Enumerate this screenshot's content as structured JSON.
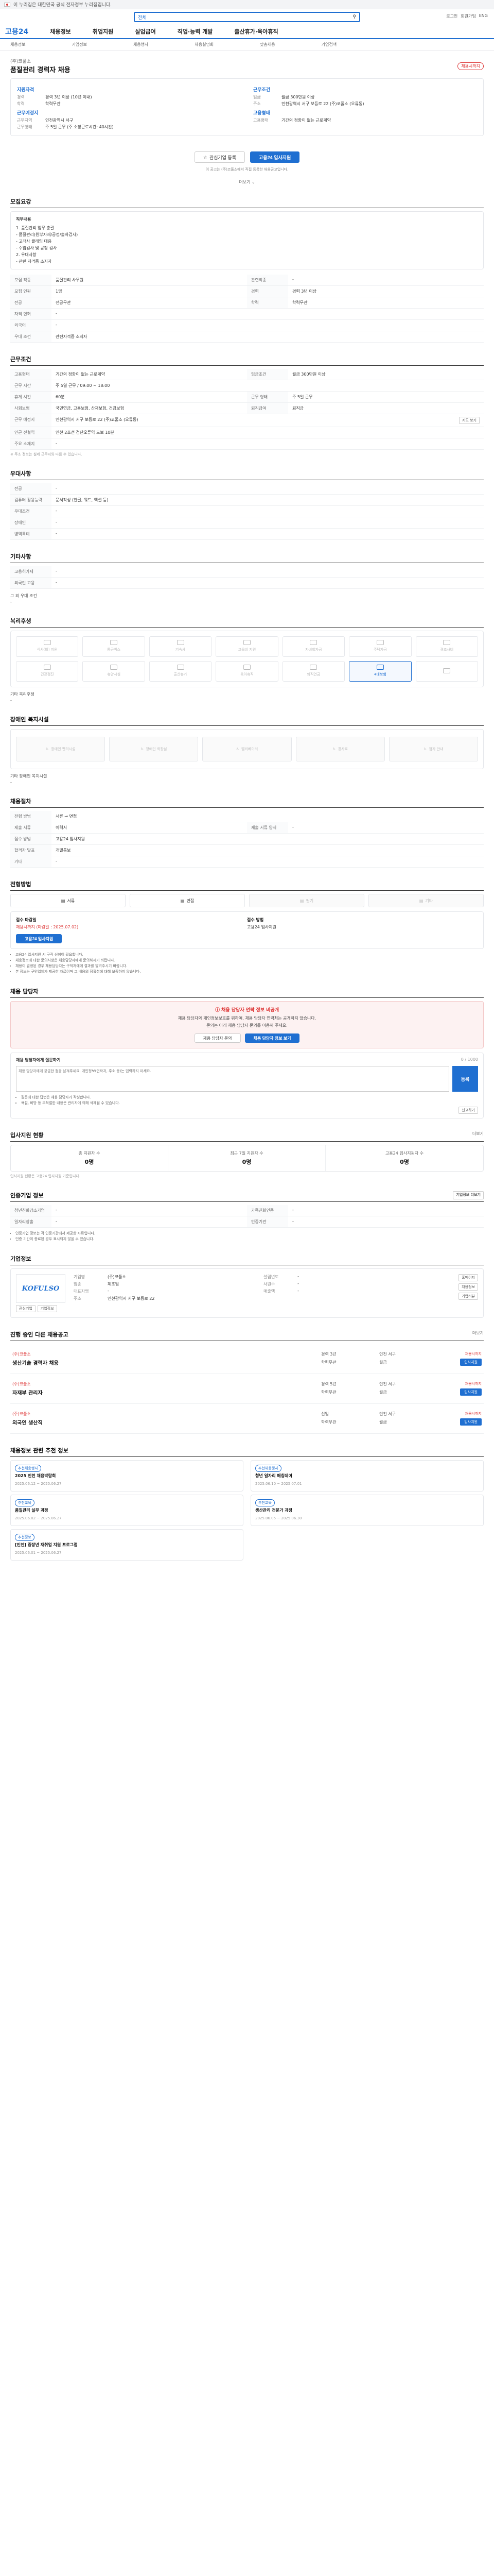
{
  "topbar": {
    "text": "이 누리집은 대한민국 공식 전자정부 누리집입니다."
  },
  "search": {
    "category": "전체",
    "placeholder": "",
    "user_links": [
      "로그인",
      "회원가입",
      "ENG"
    ]
  },
  "gnb": {
    "logo": "고용24",
    "items": [
      "채용정보",
      "취업지원",
      "실업급여",
      "직업·능력 개발",
      "출산휴가·육아휴직"
    ]
  },
  "subnav": [
    "채용정보",
    "기업정보",
    "채용행사",
    "채용설명회",
    "맞춤채용",
    "기업검색"
  ],
  "job": {
    "company": "(주)코풀소",
    "title": "품질관리 경력자 채용",
    "badge": "채용시까지",
    "summary_left_title": "지원자격",
    "summary_left": [
      {
        "k": "경력",
        "v": "경력 3년 이상 (10년 이내)"
      },
      {
        "k": "학력",
        "v": "학력무관"
      }
    ],
    "summary_left_title2": "근무예정지",
    "summary_left2": [
      {
        "k": "근무지역",
        "v": "인천광역시 서구"
      },
      {
        "k": "근무형태",
        "v": "주 5일 근무 (주 소정근로시간: 40시간)"
      }
    ],
    "summary_right_title": "근무조건",
    "summary_right": [
      {
        "k": "임금",
        "v": "월급 300만원 이상"
      },
      {
        "k": "주소",
        "v": "인천광역시 서구 보듬로 22 (주)코풀소 (오류동)"
      }
    ],
    "summary_right_title2": "고용형태",
    "summary_right2": [
      {
        "k": "고용형태",
        "v": "기간의 정함이 없는 근로계약"
      }
    ],
    "btn_interest": "관심기업 등록",
    "btn_apply": "고용24 입사지원",
    "notice": "이 공고는 (주)코풀소에서 직접 등록한 채용공고입니다.",
    "more": "더보기"
  },
  "sections": {
    "recruit": {
      "title": "모집요강",
      "duty_label": "직무내용",
      "duty_lines": [
        "1. 품질관리 업무 총괄",
        " - 품질관리(원부자재/공정/출하검사)",
        " - 고객사 클레임 대응",
        " - 수입검사 및 공정 검사",
        "2. 우대사항",
        " - 관련 자격증 소지자"
      ],
      "rows": [
        {
          "k": "모집 직종",
          "v": "품질관리 사무원",
          "k2": "관련직종",
          "v2": "-"
        },
        {
          "k": "모집 인원",
          "v": "1명",
          "k2": "경력",
          "v2": "경력 3년 이상"
        },
        {
          "k": "전공",
          "v": "전공무관",
          "k2": "학력",
          "v2": "학력무관"
        },
        {
          "k": "자격 면허",
          "v": "-",
          "k2": "",
          "v2": ""
        },
        {
          "k": "외국어",
          "v": "-",
          "k2": "",
          "v2": ""
        },
        {
          "k": "우대 조건",
          "v": "관련자격증 소지자",
          "k2": "",
          "v2": ""
        }
      ]
    },
    "condition": {
      "title": "근무조건",
      "rows": [
        {
          "k": "고용형태",
          "v": "기간의 정함이 없는 근로계약",
          "k2": "임금조건",
          "v2": "월급 300만원 이상"
        },
        {
          "k": "근무 시간",
          "v": "주 5일 근무 / 09:00 ~ 18:00",
          "k2": "",
          "v2": ""
        },
        {
          "k": "휴게 시간",
          "v": "60분",
          "k2": "근무 형태",
          "v2": "주 5일 근무"
        },
        {
          "k": "사회보험",
          "v": "국민연금, 고용보험, 산재보험, 건강보험",
          "k2": "퇴직급여",
          "v2": "퇴직금"
        },
        {
          "k": "근무 예정지",
          "v": "인천광역시 서구 보듬로 22 (주)코풀소 (오류동)",
          "k2": "",
          "v2": ""
        },
        {
          "k": "인근 전철역",
          "v": "인천 2호선 검단오류역 도보 10분",
          "k2": "",
          "v2": ""
        },
        {
          "k": "주요 소재지",
          "v": "-",
          "k2": "",
          "v2": ""
        }
      ],
      "map_btn": "지도 보기",
      "footnote": "※ 주소 정보는 실제 근무지와 다를 수 있습니다."
    },
    "etc": {
      "title": "우대사항",
      "rows": [
        {
          "k": "전공",
          "v": "-"
        },
        {
          "k": "컴퓨터 활용능력",
          "v": "문서작성 (한글, 워드, 엑셀 등)"
        },
        {
          "k": "우대조건",
          "v": "-"
        },
        {
          "k": "장애인",
          "v": "-"
        },
        {
          "k": "병역특례",
          "v": "-"
        }
      ]
    },
    "other": {
      "title": "기타사항",
      "rows": [
        {
          "k": "고용허가제",
          "v": "-"
        },
        {
          "k": "외국인 고용",
          "v": "-"
        }
      ],
      "more_label": "그 외 우대 조건",
      "more_value": "-"
    },
    "welfare": {
      "title": "복리후생",
      "cells": [
        {
          "label": "식사(비) 지원",
          "on": false
        },
        {
          "label": "통근버스",
          "on": false
        },
        {
          "label": "기숙사",
          "on": false
        },
        {
          "label": "교육비 지원",
          "on": false
        },
        {
          "label": "자녀학자금",
          "on": false
        },
        {
          "label": "주택자금",
          "on": false
        },
        {
          "label": "경조사비",
          "on": false
        },
        {
          "label": "건강검진",
          "on": false
        },
        {
          "label": "휴양시설",
          "on": false
        },
        {
          "label": "출산휴가",
          "on": false
        },
        {
          "label": "육아휴직",
          "on": false
        },
        {
          "label": "퇴직연금",
          "on": false
        },
        {
          "label": "4대보험",
          "on": true
        },
        {
          "label": "",
          "on": false
        }
      ],
      "other_label": "기타 복리후생",
      "other_value": "-"
    },
    "disabled": {
      "title": "장애인 복지시설",
      "cells": [
        "장애인 편의시설",
        "장애인 화장실",
        "엘리베이터",
        "경사로",
        "점자 안내"
      ],
      "other_label": "기타 장애인 복지시설",
      "other_value": "-"
    },
    "selection": {
      "title": "채용절차",
      "rows": [
        {
          "k": "전형 방법",
          "v": "서류 → 면접",
          "k2": "",
          "v2": ""
        },
        {
          "k": "제출 서류",
          "v": "이력서",
          "k2": "제출 서류 양식",
          "v2": "-"
        },
        {
          "k": "접수 방법",
          "v": "고용24 입사지원",
          "k2": "",
          "v2": ""
        },
        {
          "k": "합격자 발표",
          "v": "개별통보",
          "k2": "",
          "v2": ""
        },
        {
          "k": "기타",
          "v": "-",
          "k2": "",
          "v2": ""
        }
      ]
    },
    "method": {
      "title": "전형방법",
      "cells": [
        {
          "label": "서류",
          "on": true
        },
        {
          "label": "면접",
          "on": true
        },
        {
          "label": "필기",
          "on": false
        },
        {
          "label": "기타",
          "on": false
        }
      ]
    },
    "apply": {
      "l1": "접수 마감일",
      "v1": "채용시까지 (마감일 : 2025.07.02)",
      "l2": "접수 방법",
      "v2": "고용24 입사지원",
      "btn": "고용24 입사지원",
      "warnings": [
        "고용24 입사지원 시 구직 신청이 필요합니다.",
        "채용정보에 대한 문의사항은 채용담당자에게 문의하시기 바랍니다.",
        "채용이 결정된 경우 채용담당자는 구직자에게 결과를 알려주시기 바랍니다.",
        "본 정보는 구인업체가 제공한 자료이며 그 내용의 정확성에 대해 보증하지 않습니다."
      ]
    },
    "manager": {
      "title": "채용 담당자",
      "head": "채용 담당자 연락 정보 비공개",
      "body1": "채용 담당자의 개인정보보호를 위하여, 채용 담당자 연락처는 공개하지 않습니다.",
      "body2": "문의는 아래 채용 담당자 문의를 이용해 주세요.",
      "btn1": "채용 담당자 문의",
      "btn2": "채용 담당자 정보 보기",
      "inquiry_title": "채용 담당자에게 질문하기",
      "inquiry_hint": "채용 담당자에게 궁금한 점을 남겨주세요. 개인정보(연락처, 주소 등)는 입력하지 마세요.",
      "inquiry_count": "0 / 1000",
      "inquiry_submit": "등록",
      "inquiry_notes": [
        "질문에 대한 답변은 채용 담당자가 작성합니다.",
        "욕설, 비방 등 부적절한 내용은 관리자에 의해 삭제될 수 있습니다."
      ],
      "report_btn": "신고하기"
    },
    "status": {
      "title": "입사지원 현황",
      "link": "더보기",
      "cells": [
        {
          "label": "총 지원자 수",
          "num": "0명"
        },
        {
          "label": "최근 7일 지원자 수",
          "num": "0명"
        },
        {
          "label": "고용24 입사지원자 수",
          "num": "0명"
        }
      ],
      "note": "입사지원 현황은 고용24 입사지원 기준입니다."
    },
    "hist": {
      "title": "인증기업 정보",
      "btn": "기업정보 더보기",
      "rows": [
        {
          "k": "청년친화강소기업",
          "v": "-",
          "k2": "가족친화인증",
          "v2": "-"
        },
        {
          "k": "일자리창출",
          "v": "-",
          "k2": "인증기관",
          "v2": "-"
        }
      ],
      "notes": [
        "인증기업 정보는 각 인증기관에서 제공한 자료입니다.",
        "인증 기간이 종료된 경우 표시되지 않을 수 있습니다."
      ]
    },
    "company": {
      "title": "기업정보",
      "logo": "KOFULSO",
      "btn_interest": "관심기업",
      "btn_info": "기업정보",
      "rows": [
        {
          "k": "기업명",
          "v": "(주)코풀소",
          "k2": "설립년도",
          "v2": "-"
        },
        {
          "k": "업종",
          "v": "제조업",
          "k2": "사원수",
          "v2": "-"
        },
        {
          "k": "대표자명",
          "v": "-",
          "k2": "매출액",
          "v2": "-"
        },
        {
          "k": "주소",
          "v": "인천광역시 서구 보듬로 22",
          "k2": "",
          "v2": ""
        }
      ],
      "side_btns": [
        "홈페이지",
        "채용정보",
        "기업리뷰"
      ]
    },
    "similar": {
      "title": "진행 중인 다른 채용공고",
      "link": "더보기",
      "jobs": [
        {
          "cmp": "(주)코풀소",
          "ttl": "생산기술 경력자 채용",
          "m": [
            "경력 3년",
            "인천 서구",
            "학력무관",
            "월급"
          ],
          "dday": "채용시까지",
          "apply": "입사지원"
        },
        {
          "cmp": "(주)코풀소",
          "ttl": "자재부 관리자",
          "m": [
            "경력 5년",
            "인천 서구",
            "학력무관",
            "월급"
          ],
          "dday": "채용시까지",
          "apply": "입사지원"
        },
        {
          "cmp": "(주)코풀소",
          "ttl": "외국인 생산직",
          "m": [
            "신입",
            "인천 서구",
            "학력무관",
            "월급"
          ],
          "dday": "채용시까지",
          "apply": "입사지원"
        }
      ]
    },
    "news": {
      "title": "채용정보 관련 추천 정보",
      "items": [
        {
          "tag": "추천채용행사",
          "ttl": "2025 인천 채용박람회",
          "meta": "2025.06.12 ~ 2025.06.27"
        },
        {
          "tag": "추천채용행사",
          "ttl": "청년 일자리 매칭데이",
          "meta": "2025.06.10 ~ 2025.07.01"
        },
        {
          "tag": "추천교육",
          "ttl": "품질관리 실무 과정",
          "meta": "2025.06.02 ~ 2025.06.27"
        },
        {
          "tag": "추천교육",
          "ttl": "생산관리 전문가 과정",
          "meta": "2025.06.05 ~ 2025.06.30"
        },
        {
          "tag": "추천정보",
          "ttl": "[인천] 중장년 재취업 지원 프로그램",
          "meta": "2025.06.01 ~ 2025.06.27"
        }
      ]
    }
  }
}
